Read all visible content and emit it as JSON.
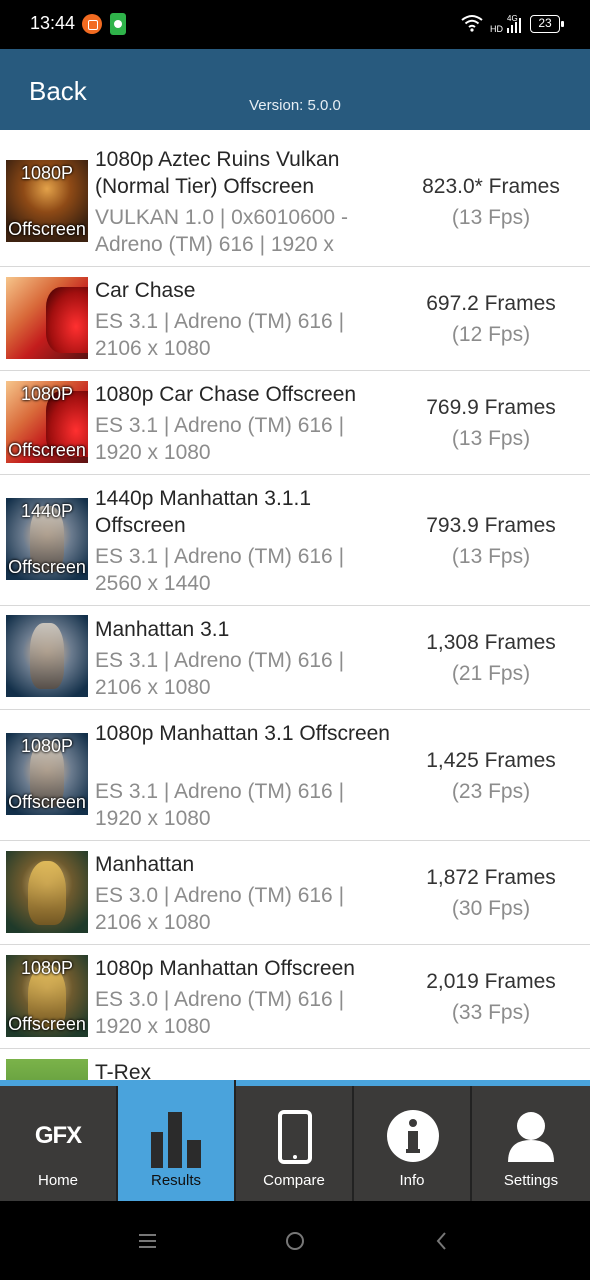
{
  "status_bar": {
    "time": "13:44",
    "network_label": "4G HD",
    "battery": "23"
  },
  "header": {
    "back_label": "Back",
    "version": "Version: 5.0.0"
  },
  "results": [
    {
      "title": "1080p Aztec Ruins Vulkan (Normal Tier) Offscreen",
      "meta": "VULKAN 1.0 | 0x6010600 - Adreno (TM) 616 | 1920 x",
      "frames": "823.0* Frames",
      "fps": "(13 Fps)",
      "badge_top": "1080P",
      "badge_bottom": "Offscreen",
      "thumb": "aztec-ruins-thumbnail"
    },
    {
      "title": "Car Chase",
      "meta": "ES 3.1 | Adreno (TM) 616 | 2106 x 1080",
      "frames": "697.2 Frames",
      "fps": "(12 Fps)",
      "badge_top": "",
      "badge_bottom": "",
      "thumb": "car-chase-thumbnail"
    },
    {
      "title": "1080p Car Chase Offscreen",
      "meta": "ES 3.1 | Adreno (TM) 616 | 1920 x 1080",
      "frames": "769.9 Frames",
      "fps": "(13 Fps)",
      "badge_top": "1080P",
      "badge_bottom": "Offscreen",
      "thumb": "car-chase-thumbnail"
    },
    {
      "title": "1440p Manhattan 3.1.1 Offscreen",
      "meta": "ES 3.1 | Adreno (TM) 616 | 2560 x 1440",
      "frames": "793.9 Frames",
      "fps": "(13 Fps)",
      "badge_top": "1440P",
      "badge_bottom": "Offscreen",
      "thumb": "manhattan-31-thumbnail"
    },
    {
      "title": "Manhattan 3.1",
      "meta": "ES 3.1 | Adreno (TM) 616 | 2106 x 1080",
      "frames": "1,308 Frames",
      "fps": "(21 Fps)",
      "badge_top": "",
      "badge_bottom": "",
      "thumb": "manhattan-31-thumbnail"
    },
    {
      "title": "1080p Manhattan 3.1 Offscreen",
      "meta": "ES 3.1 | Adreno (TM) 616 | 1920 x 1080",
      "frames": "1,425 Frames",
      "fps": "(23 Fps)",
      "badge_top": "1080P",
      "badge_bottom": "Offscreen",
      "thumb": "manhattan-31-thumbnail"
    },
    {
      "title": "Manhattan",
      "meta": "ES 3.0 | Adreno (TM) 616 | 2106 x 1080",
      "frames": "1,872 Frames",
      "fps": "(30 Fps)",
      "badge_top": "",
      "badge_bottom": "",
      "thumb": "manhattan-thumbnail"
    },
    {
      "title": "1080p Manhattan Offscreen",
      "meta": "ES 3.0 | Adreno (TM) 616 | 1920 x 1080",
      "frames": "2,019 Frames",
      "fps": "(33 Fps)",
      "badge_top": "1080P",
      "badge_bottom": "Offscreen",
      "thumb": "manhattan-thumbnail"
    },
    {
      "title": "T-Rex",
      "meta": "",
      "frames": "",
      "fps": "",
      "badge_top": "",
      "badge_bottom": "",
      "thumb": "trex-thumbnail"
    }
  ],
  "tabs": [
    {
      "label": "Home",
      "icon": "gfx-logo-icon",
      "logo_text": "GFX",
      "active": false
    },
    {
      "label": "Results",
      "icon": "bar-chart-icon",
      "active": true
    },
    {
      "label": "Compare",
      "icon": "phone-icon",
      "active": false
    },
    {
      "label": "Info",
      "icon": "info-icon",
      "active": false
    },
    {
      "label": "Settings",
      "icon": "user-icon",
      "active": false
    }
  ],
  "colors": {
    "header_bg": "#285a7e",
    "tab_active": "#4aa3dc",
    "tab_bg": "#3b3a39"
  }
}
